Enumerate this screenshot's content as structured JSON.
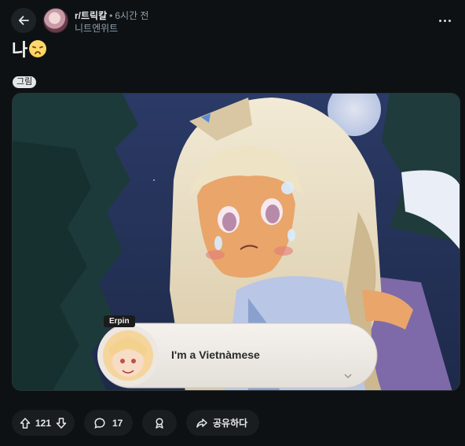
{
  "header": {
    "subreddit": "r/트릭칼",
    "separator": "•",
    "time_ago": "6시간 전",
    "author": "니트엔위트"
  },
  "post": {
    "title": "나",
    "title_emoji": "disappointed-face-emoji",
    "flair": "그림"
  },
  "media": {
    "speaker_name": "Erpin",
    "dialogue": "I'm a Vietnàmese"
  },
  "actions": {
    "upvotes": "121",
    "comments": "17",
    "share_label": "공유하다"
  },
  "icons": {
    "back": "arrow-left-icon",
    "more": "more-horizontal-icon",
    "upvote": "arrow-up-icon",
    "downvote": "arrow-down-icon",
    "comment": "speech-bubble-icon",
    "award": "award-icon",
    "share": "share-arrow-icon"
  }
}
